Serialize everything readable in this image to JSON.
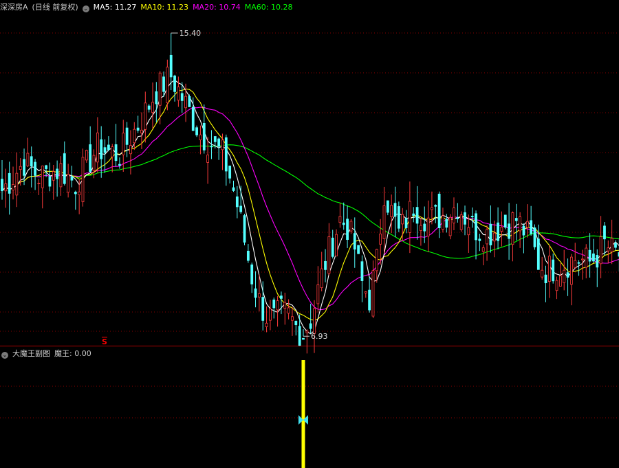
{
  "main_panel": {
    "stock_name": "深深房A",
    "period_label": "(日线 前复权)",
    "ma_legend": [
      {
        "label": "MA5: 11.27",
        "color": "#ffffff"
      },
      {
        "label": "MA10: 11.23",
        "color": "#ffff00"
      },
      {
        "label": "MA20: 10.74",
        "color": "#ff00ff"
      },
      {
        "label": "MA60: 10.28",
        "color": "#00ff00"
      }
    ],
    "high_marker": "15.40",
    "low_marker": "6.93",
    "s_marker": "S"
  },
  "sub_panel": {
    "title": "大魔王副图",
    "value_label": "魔王: 0.00"
  },
  "colors": {
    "up": "#ff3c3c",
    "down": "#54ffff",
    "grid": "#8b0000",
    "signal": "#ffff00",
    "signal_icon": "#40e0f0",
    "s_marker": "#ff0000"
  },
  "chart_data": {
    "type": "candlestick",
    "y_high": 15.4,
    "y_low": 6.93,
    "ylim": [
      6.8,
      15.9
    ],
    "anchors": [
      [
        0,
        11.0
      ],
      [
        6,
        11.8
      ],
      [
        10,
        11.4
      ],
      [
        16,
        11.6
      ],
      [
        20,
        11.2
      ],
      [
        26,
        12.2
      ],
      [
        32,
        12.0
      ],
      [
        38,
        13.0
      ],
      [
        42,
        13.8
      ],
      [
        46,
        14.2
      ],
      [
        50,
        13.4
      ],
      [
        54,
        12.6
      ],
      [
        56,
        12.4
      ],
      [
        60,
        12.0
      ],
      [
        62,
        11.4
      ],
      [
        64,
        10.6
      ],
      [
        66,
        9.6
      ],
      [
        68,
        8.6
      ],
      [
        70,
        7.9
      ],
      [
        72,
        7.5
      ],
      [
        74,
        7.4
      ],
      [
        76,
        7.6
      ],
      [
        78,
        7.5
      ],
      [
        80,
        7.2
      ],
      [
        82,
        7.0
      ],
      [
        84,
        7.4
      ],
      [
        86,
        8.2
      ],
      [
        88,
        9.0
      ],
      [
        90,
        9.6
      ],
      [
        92,
        10.2
      ],
      [
        94,
        10.0
      ],
      [
        96,
        9.4
      ],
      [
        98,
        8.4
      ],
      [
        100,
        8.0
      ],
      [
        102,
        9.0
      ],
      [
        104,
        11.0
      ],
      [
        106,
        10.4
      ],
      [
        108,
        9.8
      ],
      [
        110,
        10.2
      ],
      [
        112,
        10.6
      ],
      [
        114,
        10.4
      ],
      [
        116,
        10.2
      ],
      [
        120,
        10.3
      ],
      [
        124,
        10.6
      ],
      [
        128,
        10.0
      ],
      [
        132,
        9.8
      ],
      [
        136,
        10.0
      ],
      [
        140,
        10.2
      ],
      [
        144,
        9.6
      ],
      [
        146,
        9.0
      ],
      [
        148,
        8.8
      ],
      [
        152,
        8.9
      ],
      [
        156,
        9.1
      ],
      [
        160,
        9.0
      ],
      [
        162,
        9.2
      ],
      [
        164,
        9.5
      ],
      [
        166,
        9.3
      ],
      [
        168,
        9.2
      ]
    ],
    "signals": [
      {
        "index": 82,
        "value": 0.0
      }
    ]
  }
}
